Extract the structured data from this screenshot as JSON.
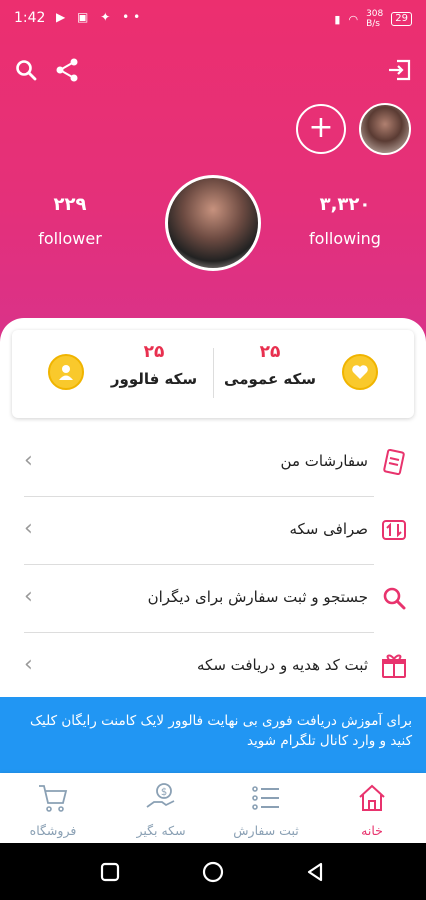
{
  "status_bar": {
    "time": "1:42",
    "network_speed_value": "308",
    "network_speed_unit": "B/s",
    "battery": "29"
  },
  "header": {
    "following_count": "۳,۳۲۰",
    "following_label": "following",
    "follower_count": "۲۲۹",
    "follower_label": "follower"
  },
  "coins": {
    "public_coin_value": "۲۵",
    "public_coin_label": "سکه عمومی",
    "follower_coin_value": "۲۵",
    "follower_coin_label": "سکه فالوور"
  },
  "menu": [
    {
      "label": "سفارشات من",
      "icon": "receipt-icon"
    },
    {
      "label": "صرافی سکه",
      "icon": "exchange-icon"
    },
    {
      "label": "جستجو و ثبت سفارش برای دیگران",
      "icon": "search-icon"
    },
    {
      "label": "ثبت کد هدیه و دریافت سکه",
      "icon": "gift-icon"
    }
  ],
  "banner": {
    "text": "برای آموزش دریافت فوری بی نهایت فالوور لایک کامنت رایگان کلیک کنید و وارد کانال تلگرام شوید"
  },
  "bottom_nav": [
    {
      "label": "خانه",
      "icon": "home-icon",
      "active": true
    },
    {
      "label": "ثبت سفارش",
      "icon": "list-icon",
      "active": false
    },
    {
      "label": "سکه بگیر",
      "icon": "coin-hand-icon",
      "active": false
    },
    {
      "label": "فروشگاه",
      "icon": "cart-icon",
      "active": false
    }
  ],
  "colors": {
    "header_pink": "#ec2f6f",
    "accent": "#e8336d",
    "coin_red": "#e8304f",
    "banner_blue": "#2196f3",
    "nav_gray": "#8aa0b4"
  }
}
